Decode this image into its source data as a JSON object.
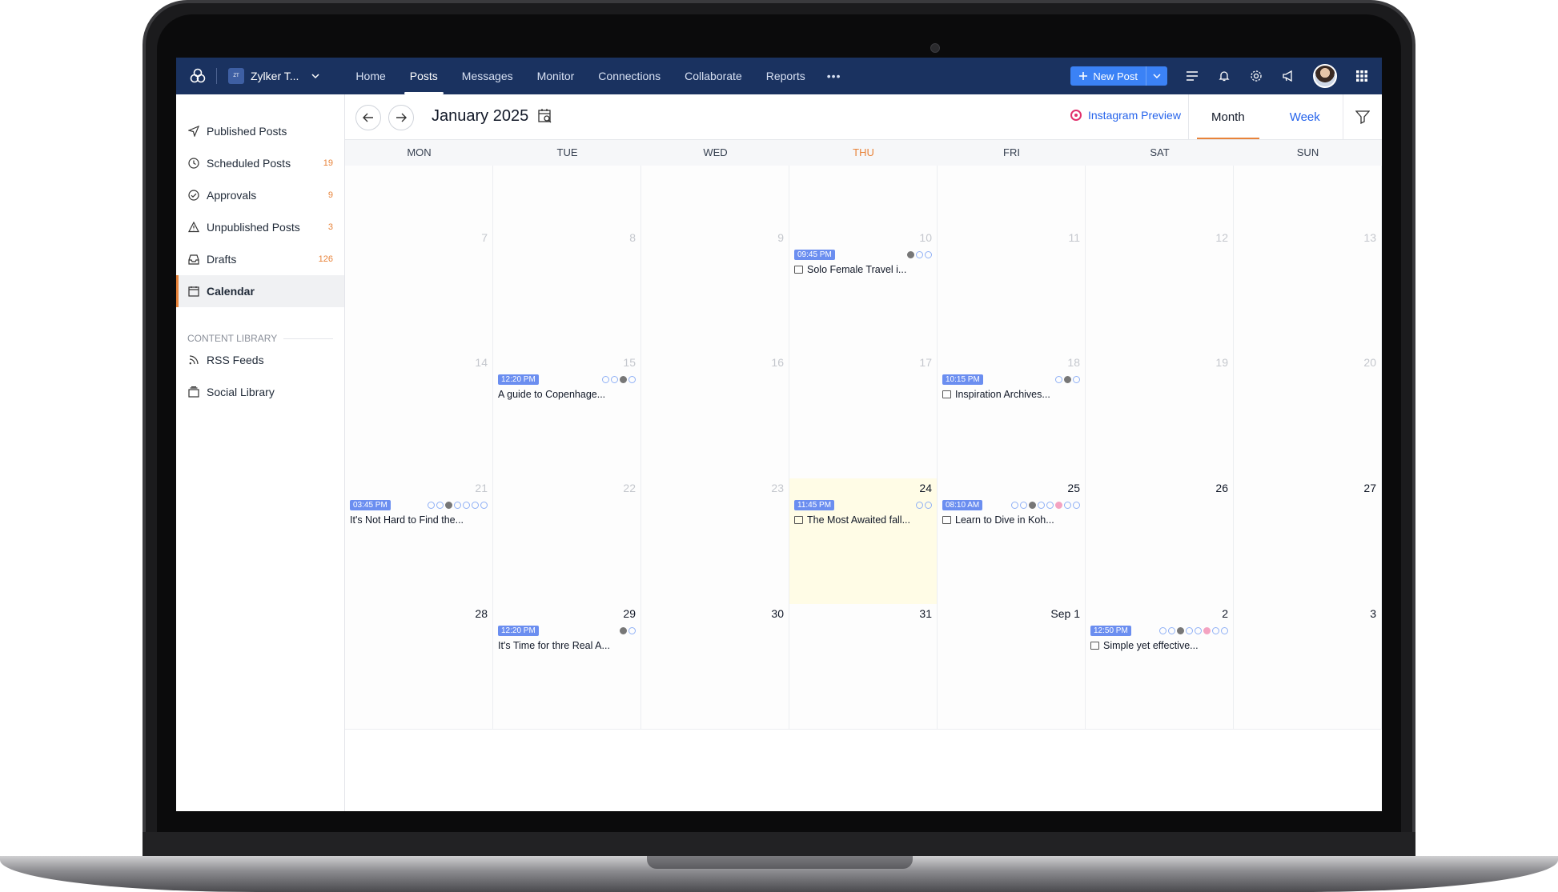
{
  "topnav": {
    "brand_name": "Zylker T...",
    "items": [
      {
        "label": "Home"
      },
      {
        "label": "Posts"
      },
      {
        "label": "Messages"
      },
      {
        "label": "Monitor"
      },
      {
        "label": "Connections"
      },
      {
        "label": "Collaborate"
      },
      {
        "label": "Reports"
      }
    ],
    "more": "•••",
    "new_post_label": "New Post"
  },
  "sidebar": {
    "items": [
      {
        "label": "Published Posts",
        "count": "",
        "icon": "send-icon"
      },
      {
        "label": "Scheduled Posts",
        "count": "19",
        "icon": "clock-icon"
      },
      {
        "label": "Approvals",
        "count": "9",
        "icon": "check-circle-icon"
      },
      {
        "label": "Unpublished Posts",
        "count": "3",
        "icon": "warning-icon"
      },
      {
        "label": "Drafts",
        "count": "126",
        "icon": "drafts-icon"
      },
      {
        "label": "Calendar",
        "count": "",
        "icon": "calendar-icon"
      }
    ],
    "library_header": "CONTENT LIBRARY",
    "library_items": [
      {
        "label": "RSS Feeds",
        "icon": "rss-icon"
      },
      {
        "label": "Social Library",
        "icon": "library-icon"
      }
    ]
  },
  "calendar": {
    "title": "January 2025",
    "instagram_preview": "Instagram Preview",
    "views": [
      "Month",
      "Week"
    ],
    "active_view": "Month",
    "days_of_week": [
      "MON",
      "TUE",
      "WED",
      "THU",
      "FRI",
      "SAT",
      "SUN"
    ],
    "accent_color": "#e8833a",
    "weeks": [
      [
        "",
        "",
        "",
        "",
        "",
        "",
        ""
      ],
      [
        "7",
        "8",
        "9",
        "10",
        "11",
        "12",
        "13"
      ],
      [
        "14",
        "15",
        "16",
        "17",
        "18",
        "19",
        "20"
      ],
      [
        "21",
        "22",
        "23",
        "24",
        "25",
        "26",
        "27"
      ],
      [
        "28",
        "29",
        "30",
        "31",
        "Sep 1",
        "2",
        "3"
      ]
    ],
    "posts": {
      "w1_d3": {
        "time": "09:45 PM",
        "title": "Solo Female Travel i..."
      },
      "w2_d1": {
        "time": "12:20 PM",
        "title": "A guide to Copenhage..."
      },
      "w2_d4": {
        "time": "10:15 PM",
        "title": "Inspiration Archives..."
      },
      "w3_d0": {
        "time": "03:45 PM",
        "title": "It's Not Hard to Find the..."
      },
      "w3_d3": {
        "time": "11:45 PM",
        "title": "The Most Awaited fall..."
      },
      "w3_d4": {
        "time": "08:10 AM",
        "title": "Learn to Dive in Koh..."
      },
      "w4_d1": {
        "time": "12:20 PM",
        "title": "It's Time for thre Real A..."
      },
      "w4_d5": {
        "time": "12:50 PM",
        "title": "Simple yet effective..."
      }
    }
  }
}
